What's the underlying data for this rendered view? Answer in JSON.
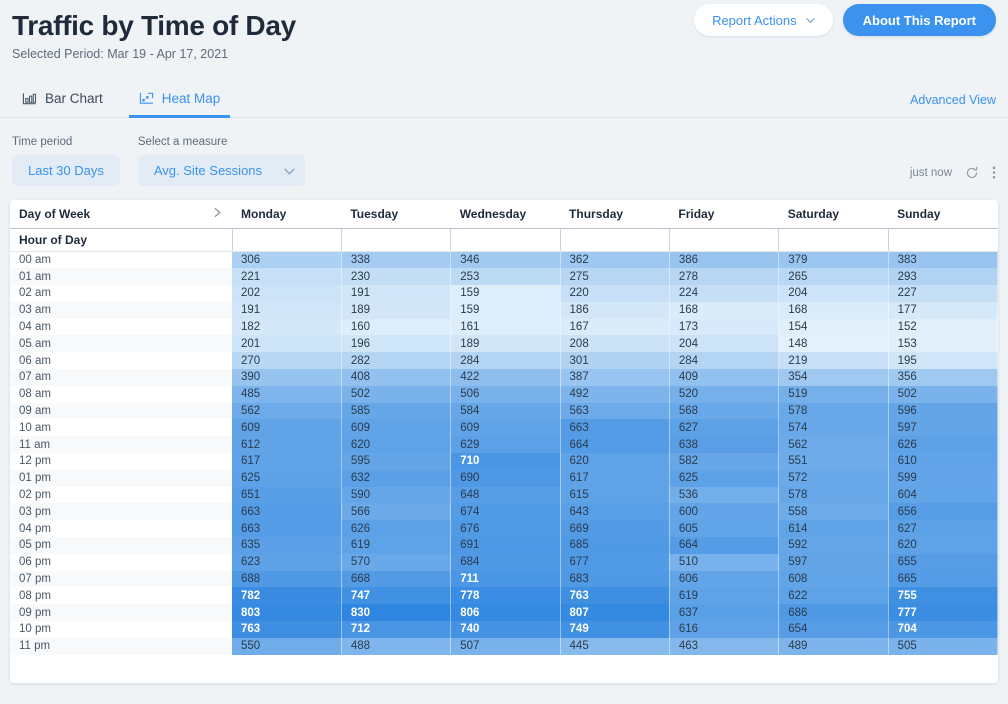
{
  "header": {
    "title": "Traffic by Time of Day",
    "subtitle": "Selected Period: Mar 19 - Apr 17, 2021",
    "report_actions_label": "Report Actions",
    "about_report_label": "About This Report"
  },
  "tabs": {
    "items": [
      {
        "label": "Bar Chart",
        "icon": "bar-chart-icon",
        "active": false
      },
      {
        "label": "Heat Map",
        "icon": "heat-map-icon",
        "active": true
      }
    ],
    "advanced_view_label": "Advanced View"
  },
  "filters": {
    "time_period_label": "Time period",
    "time_period_value": "Last 30 Days",
    "measure_label": "Select a measure",
    "measure_value": "Avg. Site Sessions",
    "refresh_status": "just now",
    "refresh_icon": "refresh-icon",
    "more_icon": "kebab-menu-icon"
  },
  "colors": {
    "accent": "#3b92ef",
    "page_background": "#eff3f6",
    "heat_min": "#e4f1fb",
    "heat_max": "#2f86e0",
    "title_text": "#1f2b3a"
  },
  "chart_data": {
    "type": "heatmap",
    "title": "Traffic by Time of Day",
    "subtitle": "Selected Period: Mar 19 - Apr 17, 2021",
    "measure": "Avg. Site Sessions",
    "row_header": "Hour of Day",
    "col_header": "Day of Week",
    "xlabel": "Day of Week",
    "ylabel": "Hour of Day",
    "columns": [
      "Monday",
      "Tuesday",
      "Wednesday",
      "Thursday",
      "Friday",
      "Saturday",
      "Sunday"
    ],
    "rows": [
      "00 am",
      "01 am",
      "02 am",
      "03 am",
      "04 am",
      "05 am",
      "06 am",
      "07 am",
      "08 am",
      "09 am",
      "10 am",
      "11 am",
      "12 pm",
      "01 pm",
      "02 pm",
      "03 pm",
      "04 pm",
      "05 pm",
      "06 pm",
      "07 pm",
      "08 pm",
      "09 pm",
      "10 pm",
      "11 pm"
    ],
    "values": [
      [
        306,
        338,
        346,
        362,
        386,
        379,
        383
      ],
      [
        221,
        230,
        253,
        275,
        278,
        265,
        293
      ],
      [
        202,
        191,
        159,
        220,
        224,
        204,
        227
      ],
      [
        191,
        189,
        159,
        186,
        168,
        168,
        177
      ],
      [
        182,
        160,
        161,
        167,
        173,
        154,
        152
      ],
      [
        201,
        196,
        189,
        208,
        204,
        148,
        153
      ],
      [
        270,
        282,
        284,
        301,
        284,
        219,
        195
      ],
      [
        390,
        408,
        422,
        387,
        409,
        354,
        356
      ],
      [
        485,
        502,
        506,
        492,
        520,
        519,
        502
      ],
      [
        562,
        585,
        584,
        563,
        568,
        578,
        596
      ],
      [
        609,
        609,
        609,
        663,
        627,
        574,
        597
      ],
      [
        612,
        620,
        629,
        664,
        638,
        562,
        626
      ],
      [
        617,
        595,
        710,
        620,
        582,
        551,
        610
      ],
      [
        625,
        632,
        690,
        617,
        625,
        572,
        599
      ],
      [
        651,
        590,
        648,
        615,
        536,
        578,
        604
      ],
      [
        663,
        566,
        674,
        643,
        600,
        558,
        656
      ],
      [
        663,
        626,
        676,
        669,
        605,
        614,
        627
      ],
      [
        635,
        619,
        691,
        685,
        664,
        592,
        620
      ],
      [
        623,
        570,
        684,
        677,
        510,
        597,
        655
      ],
      [
        688,
        668,
        711,
        683,
        606,
        608,
        665
      ],
      [
        782,
        747,
        778,
        763,
        619,
        622,
        755
      ],
      [
        803,
        830,
        806,
        807,
        637,
        686,
        777
      ],
      [
        763,
        712,
        740,
        749,
        616,
        654,
        704
      ],
      [
        550,
        488,
        507,
        445,
        463,
        489,
        505
      ]
    ],
    "value_min": 148,
    "value_max": 830,
    "legend": "none",
    "grid": true
  }
}
